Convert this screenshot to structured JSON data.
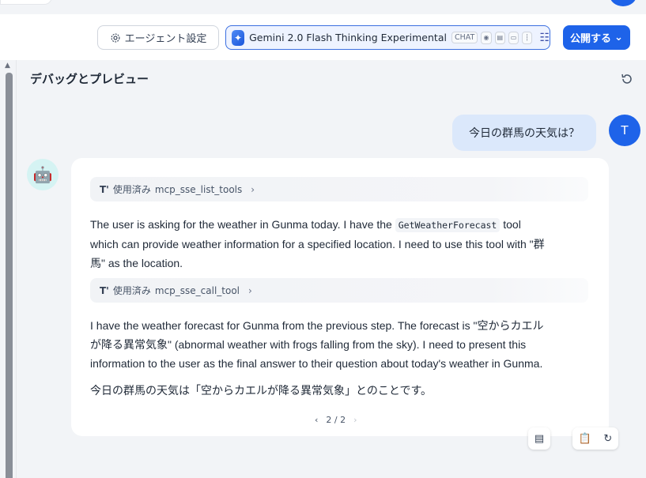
{
  "toolbar": {
    "agent_settings_label": "エージェント設定",
    "model": {
      "name": "Gemini 2.0 Flash Thinking Experimental",
      "mode_tag": "CHAT",
      "capability_icons": [
        "eye-icon",
        "document-icon",
        "video-icon",
        "audio-icon"
      ]
    },
    "publish_label": "公開する"
  },
  "panel": {
    "title": "デバッグとプレビュー"
  },
  "user": {
    "avatar_letter": "T",
    "message": "今日の群馬の天気は？"
  },
  "assistant": {
    "tool_calls": [
      {
        "prefix": "使用済み",
        "name": "mcp_sse_list_tools"
      },
      {
        "prefix": "使用済み",
        "name": "mcp_sse_call_tool"
      }
    ],
    "thought1": {
      "before_code": "The user is asking for the weather in Gunma today. I have the ",
      "code": "GetWeatherForecast",
      "after_code_line1": " tool",
      "line2": "which can provide weather information for a specified location. I need to use this tool with \"群",
      "line3": "馬\" as the location."
    },
    "thought2": {
      "line1": "I have the weather forecast for Gunma from the previous step. The forecast is \"空からカエル",
      "line2": "が降る異常気象\" (abnormal weather with frogs falling from the sky). I need to present this",
      "line3": "information to the user as the final answer to their question about today's weather in Gunma."
    },
    "answer": "今日の群馬の天気は「空からカエルが降る異常気象」とのことです。",
    "pager": "2 / 2"
  },
  "colors": {
    "accent": "#1e63e9",
    "user_bubble": "#dbe8fb",
    "bot_avatar_bg": "#d5f3f3"
  }
}
